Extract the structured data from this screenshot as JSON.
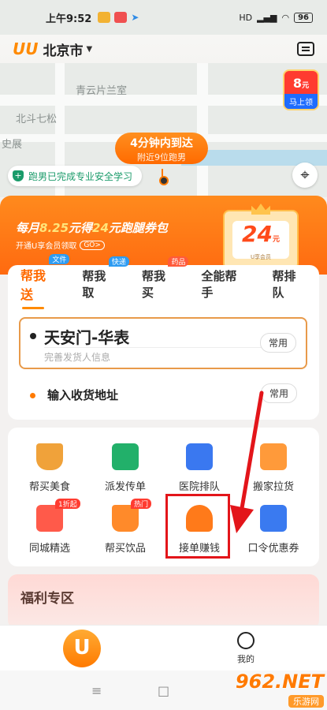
{
  "status_bar": {
    "time": "上午9:52",
    "battery": "96",
    "network": "HD"
  },
  "header": {
    "logo": "UU",
    "city": "北京市"
  },
  "map": {
    "labels": [
      "青云片兰室",
      "北斗七松",
      "史展"
    ],
    "coupon": {
      "amount": "8",
      "unit": "元",
      "action": "马上领"
    },
    "eta_bubble": {
      "line1": "4分钟内到达",
      "line2": "附近9位跑男"
    },
    "safety_notice": "跑男已完成专业安全学习"
  },
  "promo": {
    "headline_prefix": "每月",
    "headline_price": "8.25",
    "headline_mid": "元得",
    "headline_amount": "24",
    "headline_suffix": "元跑腿券包",
    "subline": "开通U享会员领取",
    "go_label": "GO>",
    "ticket_value": "24",
    "ticket_unit": "元",
    "ticket_caption": "U享会员"
  },
  "tabs": [
    {
      "label": "帮我送",
      "tag": "文件",
      "tag_color": "#2e9cf2"
    },
    {
      "label": "帮我取",
      "tag": "快递",
      "tag_color": "#2e9cf2"
    },
    {
      "label": "帮我买",
      "tag": "药品",
      "tag_color": "#ff5a3a"
    },
    {
      "label": "全能帮手",
      "tag": "",
      "tag_color": ""
    },
    {
      "label": "帮排队",
      "tag": "",
      "tag_color": ""
    }
  ],
  "address": {
    "pickup": "天安门-华表",
    "pickup_hint": "完善发货人信息",
    "common_label": "常用",
    "delivery_placeholder": "输入收货地址"
  },
  "services": [
    {
      "label": "帮买美食",
      "color": "#f0a23a",
      "badge": ""
    },
    {
      "label": "派发传单",
      "color": "#22b06a",
      "badge": ""
    },
    {
      "label": "医院排队",
      "color": "#3a78f0",
      "badge": ""
    },
    {
      "label": "搬家拉货",
      "color": "#ff9a3a",
      "badge": ""
    },
    {
      "label": "同城精选",
      "color": "#ff5a4a",
      "badge": "1折起"
    },
    {
      "label": "帮买饮品",
      "color": "#ff8a2a",
      "badge": "热门"
    },
    {
      "label": "接单赚钱",
      "color": "#ff7a1a",
      "badge": ""
    },
    {
      "label": "口令优惠券",
      "color": "#3a7af0",
      "badge": ""
    }
  ],
  "welfare": {
    "title": "福利专区"
  },
  "bottom_nav": {
    "home": "U",
    "me": "我的"
  },
  "watermark": {
    "brand": "962.NET",
    "sub": "乐游网"
  }
}
